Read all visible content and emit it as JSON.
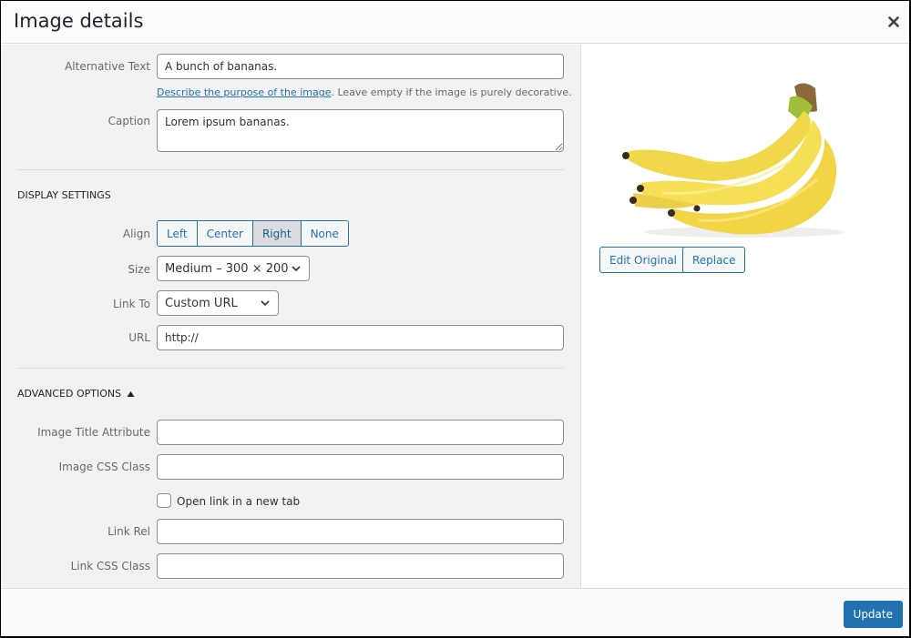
{
  "modal": {
    "title": "Image details",
    "close_icon": "close-icon"
  },
  "attachment": {
    "alt_text_label": "Alternative Text",
    "alt_text_value": "A bunch of bananas.",
    "alt_help_link": "Describe the purpose of the image",
    "alt_help_text": ". Leave empty if the image is purely decorative.",
    "caption_label": "Caption",
    "caption_value": "Lorem ipsum bananas."
  },
  "display_settings": {
    "title": "Display Settings",
    "align_label": "Align",
    "align_options": [
      "Left",
      "Center",
      "Right",
      "None"
    ],
    "align_selected": "Right",
    "size_label": "Size",
    "size_value": "Medium – 300 × 200",
    "link_to_label": "Link To",
    "link_to_value": "Custom URL",
    "url_label": "URL",
    "url_value": "http://"
  },
  "advanced_options": {
    "title": "Advanced Options",
    "toggle_icon": "triangle-up-icon",
    "image_title_label": "Image Title Attribute",
    "image_title_value": "",
    "image_css_label": "Image CSS Class",
    "image_css_value": "",
    "new_tab_label": "Open link in a new tab",
    "new_tab_checked": false,
    "link_rel_label": "Link Rel",
    "link_rel_value": "",
    "link_css_label": "Link CSS Class",
    "link_css_value": ""
  },
  "preview": {
    "image_alt": "A bunch of bananas.",
    "edit_original_label": "Edit Original",
    "replace_label": "Replace"
  },
  "footer": {
    "update_label": "Update"
  },
  "colors": {
    "accent": "#2271b1",
    "panel_bg": "#f2f2f2"
  }
}
